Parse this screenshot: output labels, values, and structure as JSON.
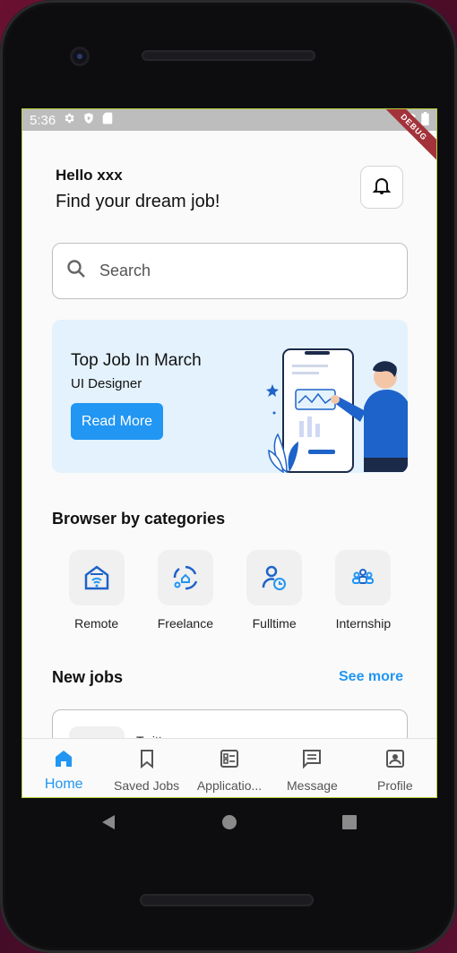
{
  "status_bar": {
    "time": "5:36",
    "debug_label": "DEBUG"
  },
  "header": {
    "greeting": "Hello xxx",
    "tagline": "Find your dream job!"
  },
  "search": {
    "placeholder": "Search"
  },
  "banner": {
    "title": "Top Job In March",
    "subtitle": "UI Designer",
    "button_label": "Read More"
  },
  "categories": {
    "title": "Browser by categories",
    "items": [
      {
        "label": "Remote",
        "icon": "remote-home-icon"
      },
      {
        "label": "Freelance",
        "icon": "freelance-cycle-icon"
      },
      {
        "label": "Fulltime",
        "icon": "fulltime-person-clock-icon"
      },
      {
        "label": "Internship",
        "icon": "internship-group-icon"
      }
    ]
  },
  "new_jobs": {
    "title": "New jobs",
    "see_more": "See more",
    "first_job_name": "Twitt..."
  },
  "bottom_nav": {
    "items": [
      {
        "label": "Home",
        "icon": "home-icon",
        "active": true
      },
      {
        "label": "Saved Jobs",
        "icon": "bookmark-icon",
        "active": false
      },
      {
        "label": "Applicatio...",
        "icon": "applications-icon",
        "active": false
      },
      {
        "label": "Message",
        "icon": "message-icon",
        "active": false
      },
      {
        "label": "Profile",
        "icon": "profile-icon",
        "active": false
      }
    ]
  },
  "colors": {
    "accent": "#2196f3",
    "banner_bg": "#e3f2fd",
    "illustration_blue": "#1e63c9"
  }
}
